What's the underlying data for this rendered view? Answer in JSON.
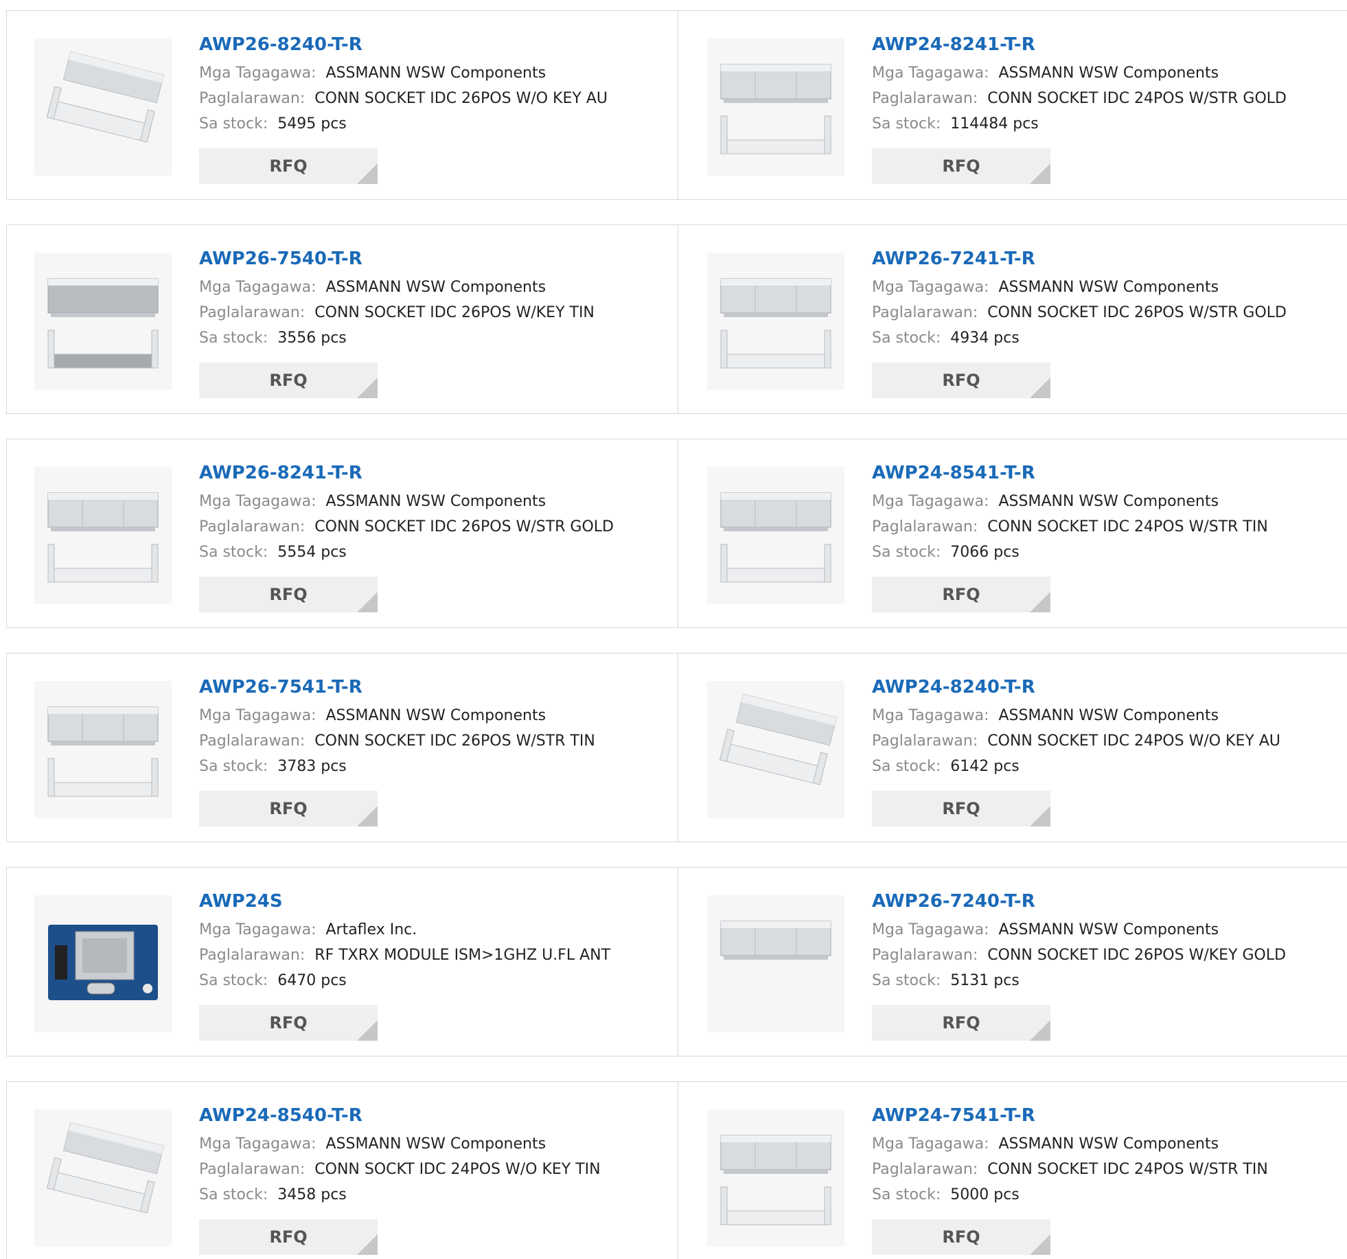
{
  "labels": {
    "manufacturer": "Mga Tagagawa:",
    "description": "Paglalarawan:",
    "stock": "Sa stock:",
    "rfq": "RFQ"
  },
  "colors": {
    "title": "#1a6ab8",
    "label": "#8a8a8a",
    "border": "#d8d8d8",
    "button": "#efefef"
  },
  "products": [
    {
      "part": "AWP26-8240-T-R",
      "manufacturer": "ASSMANN WSW Components",
      "description": "CONN SOCKET IDC 26POS W/O KEY AU",
      "stock": "5495 pcs",
      "image": "angled-idc-socket"
    },
    {
      "part": "AWP24-8241-T-R",
      "manufacturer": "ASSMANN WSW Components",
      "description": "CONN SOCKET IDC 24POS W/STR GOLD",
      "stock": "114484 pcs",
      "image": "idc-socket-strain-relief"
    },
    {
      "part": "AWP26-7540-T-R",
      "manufacturer": "ASSMANN WSW Components",
      "description": "CONN SOCKET IDC 26POS W/KEY TIN",
      "stock": "3556 pcs",
      "image": "idc-socket-dark"
    },
    {
      "part": "AWP26-7241-T-R",
      "manufacturer": "ASSMANN WSW Components",
      "description": "CONN SOCKET IDC 26POS W/STR GOLD",
      "stock": "4934 pcs",
      "image": "idc-socket-strain-relief"
    },
    {
      "part": "AWP26-8241-T-R",
      "manufacturer": "ASSMANN WSW Components",
      "description": "CONN SOCKET IDC 26POS W/STR GOLD",
      "stock": "5554 pcs",
      "image": "idc-socket-strain-relief"
    },
    {
      "part": "AWP24-8541-T-R",
      "manufacturer": "ASSMANN WSW Components",
      "description": "CONN SOCKET IDC 24POS W/STR TIN",
      "stock": "7066 pcs",
      "image": "idc-socket-strain-relief"
    },
    {
      "part": "AWP26-7541-T-R",
      "manufacturer": "ASSMANN WSW Components",
      "description": "CONN SOCKET IDC 26POS W/STR TIN",
      "stock": "3783 pcs",
      "image": "idc-socket-strain-relief"
    },
    {
      "part": "AWP24-8240-T-R",
      "manufacturer": "ASSMANN WSW Components",
      "description": "CONN SOCKET IDC 24POS W/O KEY AU",
      "stock": "6142 pcs",
      "image": "angled-idc-socket"
    },
    {
      "part": "AWP24S",
      "manufacturer": "Artaflex Inc.",
      "description": "RF TXRX MODULE ISM>1GHZ U.FL ANT",
      "stock": "6470 pcs",
      "image": "rf-module-board"
    },
    {
      "part": "AWP26-7240-T-R",
      "manufacturer": "ASSMANN WSW Components",
      "description": "CONN SOCKET IDC 26POS W/KEY GOLD",
      "stock": "5131 pcs",
      "image": "idc-socket-single"
    },
    {
      "part": "AWP24-8540-T-R",
      "manufacturer": "ASSMANN WSW Components",
      "description": "CONN SOCKT IDC 24POS W/O KEY TIN",
      "stock": "3458 pcs",
      "image": "angled-idc-socket-open"
    },
    {
      "part": "AWP24-7541-T-R",
      "manufacturer": "ASSMANN WSW Components",
      "description": "CONN SOCKET IDC 24POS W/STR TIN",
      "stock": "5000 pcs",
      "image": "idc-socket-strain-relief"
    }
  ]
}
